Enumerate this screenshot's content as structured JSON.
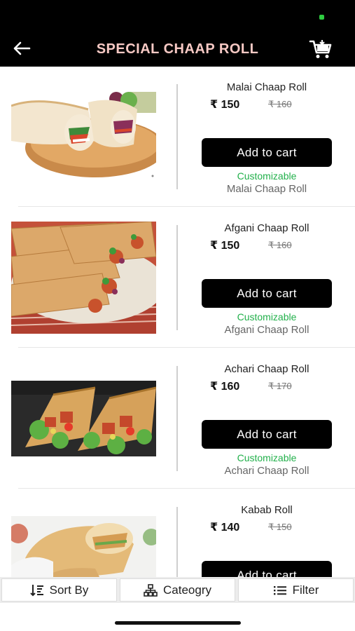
{
  "header": {
    "title": "SPECIAL CHAAP ROLL"
  },
  "currency": "₹",
  "products": [
    {
      "name": "Malai Chaap Roll",
      "price": "₹ 150",
      "mrp": "₹ 160",
      "button": "Add to cart",
      "tag": "Customizable",
      "subtitle": "Malai Chaap Roll"
    },
    {
      "name": "Afgani Chaap Roll",
      "price": "₹ 150",
      "mrp": "₹ 160",
      "button": "Add to cart",
      "tag": "Customizable",
      "subtitle": "Afgani Chaap Roll"
    },
    {
      "name": "Achari Chaap Roll",
      "price": "₹ 160",
      "mrp": "₹ 170",
      "button": "Add to cart",
      "tag": "Customizable",
      "subtitle": "Achari Chaap Roll"
    },
    {
      "name": "Kabab Roll",
      "price": "₹ 140",
      "mrp": "₹ 150",
      "button": "Add to cart",
      "tag": "",
      "subtitle": ""
    }
  ],
  "bottom_bar": {
    "sort": "Sort By",
    "category": "Cateogry",
    "filter": "Filter"
  },
  "colors": {
    "accent_green": "#22b04b",
    "title_pink": "#f7c9c4",
    "button_black": "#000000"
  },
  "icons": {
    "back": "arrow-left-icon",
    "cart": "cart-icon",
    "sort": "sort-icon",
    "category": "category-tree-icon",
    "filter": "filter-list-icon"
  }
}
